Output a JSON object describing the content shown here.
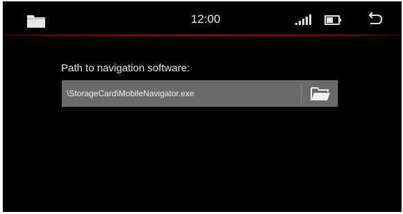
{
  "status_bar": {
    "left_icon": "folder-icon",
    "clock": "12:00",
    "signal_icon": "signal-strength-icon",
    "battery_icon": "battery-icon",
    "back_icon": "back-arrow-icon"
  },
  "main": {
    "label": "Path to navigation software:",
    "path_value": "\\StorageCard\\MobileNavigator.exe",
    "browse_icon": "open-folder-icon"
  },
  "colors": {
    "background": "#000000",
    "divider": "#b40000",
    "field_background": "#6a6a6a",
    "text": "#e8e8e8"
  }
}
